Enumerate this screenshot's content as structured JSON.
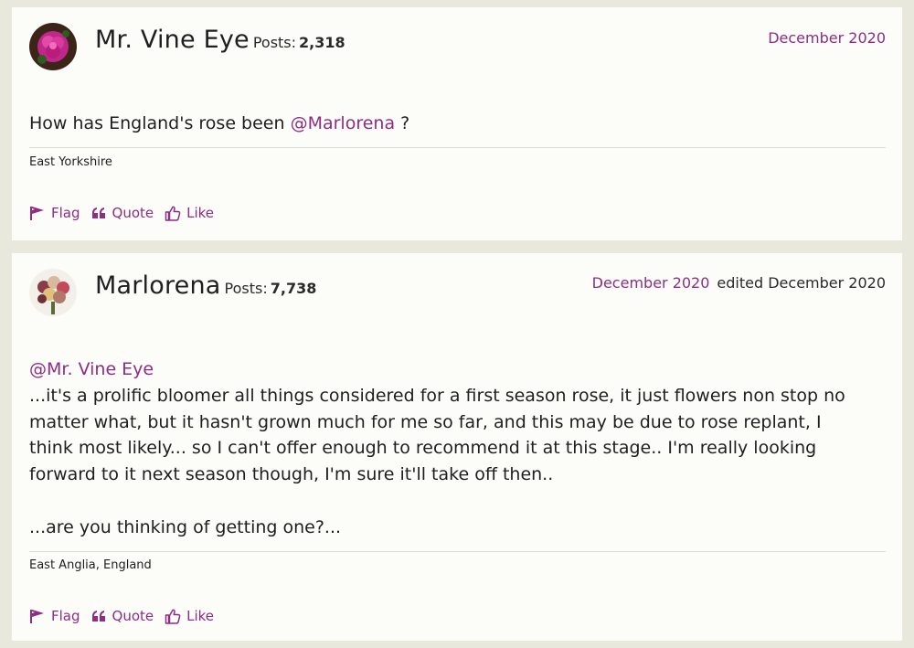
{
  "colors": {
    "accent": "#8e2d84",
    "background": "#e9e8dd",
    "card": "#fcfcf9"
  },
  "posts": [
    {
      "author": "Mr. Vine Eye",
      "posts_label": "Posts:",
      "posts_count": "2,318",
      "date": "December 2020",
      "mention": "",
      "body_prefix": "How has England's rose been ",
      "body_mention": "@Marlorena",
      "body_suffix": " ?",
      "location": "East Yorkshire",
      "actions": {
        "flag": "Flag",
        "quote": "Quote",
        "like": "Like"
      },
      "avatar_icon": "pink-flower-avatar"
    },
    {
      "author": "Marlorena",
      "posts_label": "Posts:",
      "posts_count": "7,738",
      "date": "December 2020",
      "edited": "edited December 2020",
      "mention": "@Mr. Vine Eye",
      "body_lines": [
        "...it's a prolific bloomer all things considered for a first season rose, it just flowers non stop no",
        "matter what,  but it hasn't grown much for me so far, and this may be due to rose replant, I",
        "think most likely...  so I can't offer enough to recommend it at this stage..   I'm really looking",
        "forward to it next season though, I'm sure it'll take off then.."
      ],
      "body_extra": "...are you thinking of getting one?...",
      "location": "East Anglia, England",
      "actions": {
        "flag": "Flag",
        "quote": "Quote",
        "like": "Like"
      },
      "avatar_icon": "rose-bouquet-avatar"
    }
  ]
}
